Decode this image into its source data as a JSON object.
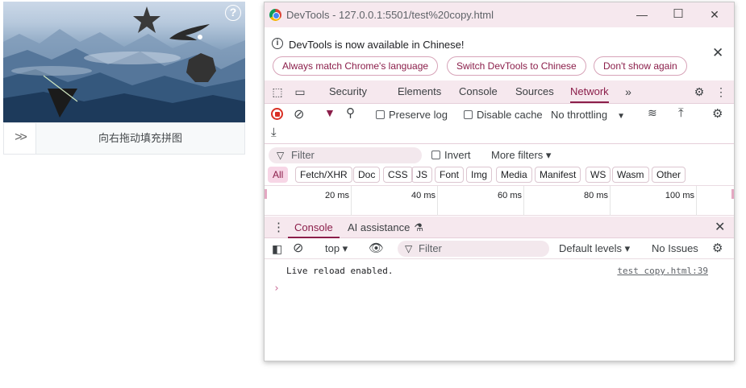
{
  "captcha": {
    "help_icon": "question-circle-icon",
    "slider_handle": ">>",
    "slider_text": "向右拖动填充拼图"
  },
  "window": {
    "title": "DevTools - 127.0.0.1:5501/test%20copy.html",
    "min_icon": "—",
    "max_icon": "☐",
    "close_icon": "✕"
  },
  "infobar": {
    "message": "DevTools is now available in Chinese!",
    "buttons": [
      "Always match Chrome's language",
      "Switch DevTools to Chinese",
      "Don't show again"
    ],
    "close": "✕"
  },
  "tabs": [
    "Security",
    "Elements",
    "Console",
    "Sources",
    "Network"
  ],
  "tabs_more": "»",
  "network_toolbar": {
    "preserve_log": "Preserve log",
    "disable_cache": "Disable cache",
    "throttling": "No throttling"
  },
  "filter": {
    "placeholder": "Filter",
    "invert": "Invert",
    "more_filters": "More filters ▾"
  },
  "types": [
    "All",
    "Fetch/XHR",
    "Doc",
    "CSS",
    "JS",
    "Font",
    "Img",
    "Media",
    "Manifest",
    "WS",
    "Wasm",
    "Other"
  ],
  "timeline_ticks": [
    "20 ms",
    "40 ms",
    "60 ms",
    "80 ms",
    "100 ms"
  ],
  "drawer": {
    "console_tab": "Console",
    "ai_tab": "AI assistance"
  },
  "console_toolbar": {
    "context": "top ▾",
    "filter_placeholder": "Filter",
    "levels": "Default levels ▾",
    "issues": "No Issues"
  },
  "console": {
    "message": "Live reload enabled.",
    "source": "test copy.html:39",
    "prompt": "›"
  },
  "colors": {
    "accent": "#8b1e4a",
    "titlebar": "#f6e8ee"
  }
}
